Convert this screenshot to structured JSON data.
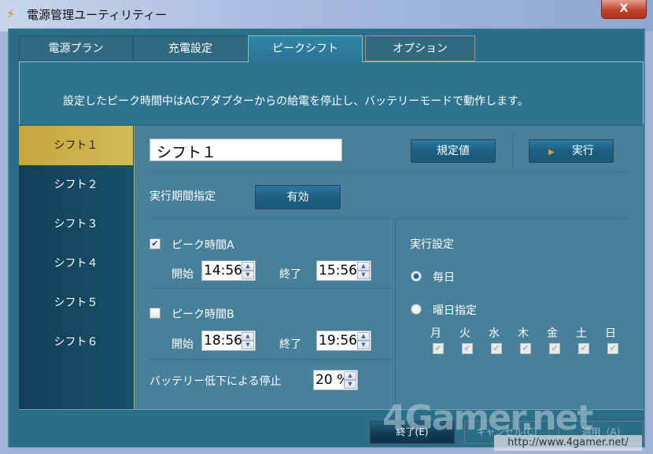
{
  "window": {
    "title": "電源管理ユーティリティー",
    "close_label": "X"
  },
  "tabs": [
    {
      "label": "電源プラン"
    },
    {
      "label": "充電設定"
    },
    {
      "label": "ピークシフト"
    },
    {
      "label": "オプション"
    }
  ],
  "banner": "設定したピーク時間中はACアダプターからの給電を停止し、バッテリーモードで動作します。",
  "shifts": [
    {
      "label": "シフト１"
    },
    {
      "label": "シフト２"
    },
    {
      "label": "シフト３"
    },
    {
      "label": "シフト４"
    },
    {
      "label": "シフト５"
    },
    {
      "label": "シフト６"
    }
  ],
  "main": {
    "name_value": "シフト１",
    "default_button": "規定値",
    "run_button": "実行",
    "period_label": "実行期間指定",
    "period_button": "有効",
    "peak_a": {
      "label": "ピーク時間A",
      "checked": true,
      "start_label": "開始",
      "start": "14:56",
      "end_label": "終了",
      "end": "15:56"
    },
    "peak_b": {
      "label": "ピーク時間B",
      "checked": false,
      "start_label": "開始",
      "start": "18:56",
      "end_label": "終了",
      "end": "19:56"
    },
    "battery_label": "バッテリー低下による停止",
    "battery_value": "20 %",
    "exec_title": "実行設定",
    "everyday": "毎日",
    "weekday": "曜日指定",
    "days": [
      "月",
      "火",
      "水",
      "木",
      "金",
      "土",
      "日"
    ]
  },
  "footer": {
    "exit": "終了(E)",
    "cancel": "キャンセル(C)",
    "apply": "適用（A)"
  },
  "watermark": {
    "logo": "4Gamer.net",
    "url": "http://www.4gamer.net/"
  }
}
